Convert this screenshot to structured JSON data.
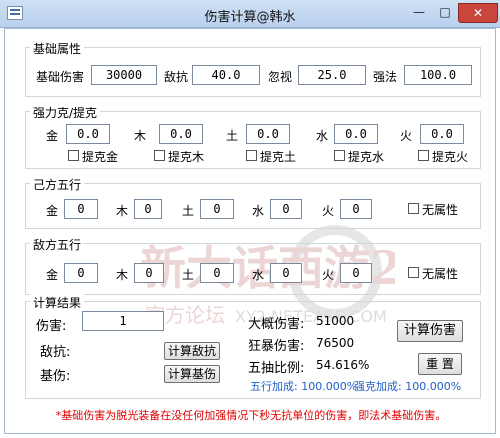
{
  "window": {
    "title": "伤害计算@韩水",
    "minimize": "—",
    "maximize": "□",
    "close": "✕"
  },
  "basic": {
    "group_title": "基础属性",
    "fields": [
      {
        "label": "基础伤害",
        "value": "30000"
      },
      {
        "label": "敌抗",
        "value": "40.0"
      },
      {
        "label": "忽视",
        "value": "25.0"
      },
      {
        "label": "强法",
        "value": "100.0"
      }
    ]
  },
  "strong": {
    "group_title": "强力克/提克",
    "elements": [
      {
        "label": "金",
        "value": "0.0",
        "check": "提克金"
      },
      {
        "label": "木",
        "value": "0.0",
        "check": "提克木"
      },
      {
        "label": "土",
        "value": "0.0",
        "check": "提克土"
      },
      {
        "label": "水",
        "value": "0.0",
        "check": "提克水"
      },
      {
        "label": "火",
        "value": "0.0",
        "check": "提克火"
      }
    ]
  },
  "own": {
    "group_title": "己方五行",
    "elements": [
      {
        "label": "金",
        "value": "0"
      },
      {
        "label": "木",
        "value": "0"
      },
      {
        "label": "土",
        "value": "0"
      },
      {
        "label": "水",
        "value": "0"
      },
      {
        "label": "火",
        "value": "0"
      }
    ],
    "none_label": "无属性"
  },
  "enemy": {
    "group_title": "敌方五行",
    "elements": [
      {
        "label": "金",
        "value": "0"
      },
      {
        "label": "木",
        "value": "0"
      },
      {
        "label": "土",
        "value": "0"
      },
      {
        "label": "水",
        "value": "0"
      },
      {
        "label": "火",
        "value": "0"
      }
    ],
    "none_label": "无属性"
  },
  "result": {
    "group_title": "计算结果",
    "damage_label": "伤害:",
    "damage_value": "1",
    "resist_label": "敌抗:",
    "base_label": "基伤:",
    "calc_resist_btn": "计算敌抗",
    "calc_base_btn": "计算基伤",
    "approx_label": "大概伤害:",
    "approx_value": "51000",
    "crit_label": "狂暴伤害:",
    "crit_value": "76500",
    "ratio_label": "五抽比例:",
    "ratio_value": "54.616%",
    "calc_damage_btn": "计算伤害",
    "reset_btn": "重  置",
    "wuxing_bonus": "五行加成: 100.000%",
    "restrain_bonus": "强克加成: 100.000%"
  },
  "watermark": {
    "main": "新大话西游2",
    "sub": "官方论坛",
    "domain": "XY2.NETEASE.COM"
  },
  "note": "*基础伤害为脱光装备在没任何加强情况下秒无抗单位的伤害，即法术基础伤害。"
}
